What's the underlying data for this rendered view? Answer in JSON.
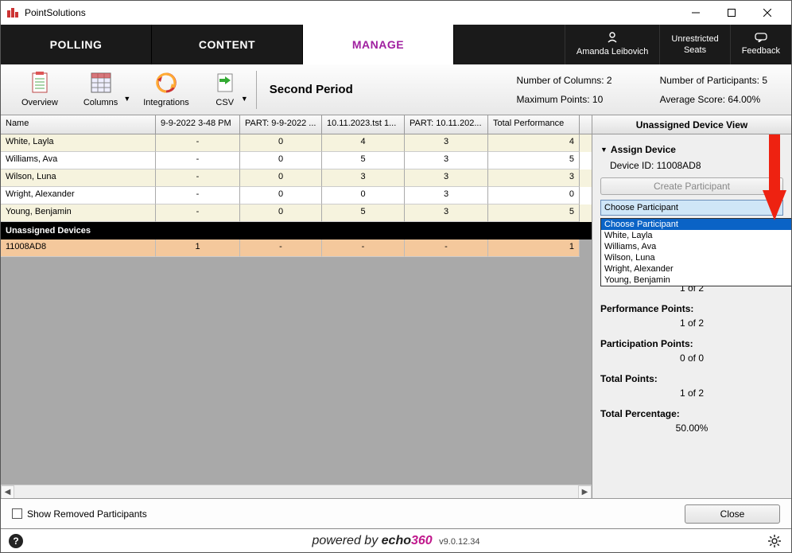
{
  "app": {
    "title": "PointSolutions"
  },
  "tabs": {
    "polling": "POLLING",
    "content": "CONTENT",
    "manage": "MANAGE"
  },
  "user_section": {
    "user_name": "Amanda Leibovich",
    "seats_top": "Unrestricted",
    "seats_bottom": "Seats",
    "feedback": "Feedback"
  },
  "toolbar": {
    "overview": "Overview",
    "columns": "Columns",
    "integrations": "Integrations",
    "csv": "CSV",
    "period": "Second Period",
    "stats": {
      "cols_label": "Number of Columns: 2",
      "max_label": "Maximum Points: 10",
      "participants_label": "Number of Participants: 5",
      "avg_label": "Average Score: 64.00%"
    }
  },
  "grid": {
    "headers": [
      "Name",
      "9-9-2022 3-48 PM",
      "PART: 9-9-2022 ...",
      "10.11.2023.tst 1...",
      "PART: 10.11.202...",
      "Total Performance"
    ],
    "rows": [
      {
        "cells": [
          "White, Layla",
          "-",
          "0",
          "4",
          "3",
          "4"
        ]
      },
      {
        "cells": [
          "Williams, Ava",
          "-",
          "0",
          "5",
          "3",
          "5"
        ]
      },
      {
        "cells": [
          "Wilson, Luna",
          "-",
          "0",
          "3",
          "3",
          "3"
        ]
      },
      {
        "cells": [
          "Wright, Alexander",
          "-",
          "0",
          "0",
          "3",
          "0"
        ]
      },
      {
        "cells": [
          "Young, Benjamin",
          "-",
          "0",
          "5",
          "3",
          "5"
        ]
      }
    ],
    "section_label": "Unassigned Devices",
    "unassigned_row": {
      "cells": [
        "11008AD8",
        "1",
        "-",
        "-",
        "-",
        "1"
      ]
    }
  },
  "side": {
    "header": "Unassigned Device View",
    "assign_label": "Assign Device",
    "device_id_label": "Device ID: 11008AD8",
    "create_btn": "Create Participant",
    "combo_selected": "Choose Participant",
    "combo_options": [
      "Choose Participant",
      "White, Layla",
      "Williams, Ava",
      "Wilson, Luna",
      "Wright, Alexander",
      "Young, Benjamin"
    ],
    "stats": {
      "perf_label": "Performance Points:",
      "perf_val": "1 of 2",
      "part_label": "Participation Points:",
      "part_val": "0 of 0",
      "total_label": "Total Points:",
      "total_val": "1 of 2",
      "pct_label": "Total Percentage:",
      "pct_val": "50.00%",
      "top_val": "1 of 2"
    }
  },
  "bottom": {
    "checkbox_label": "Show Removed Participants",
    "close": "Close"
  },
  "footer": {
    "powered": "powered by",
    "brand": "echo",
    "three60": "360",
    "version": "v9.0.12.34"
  }
}
